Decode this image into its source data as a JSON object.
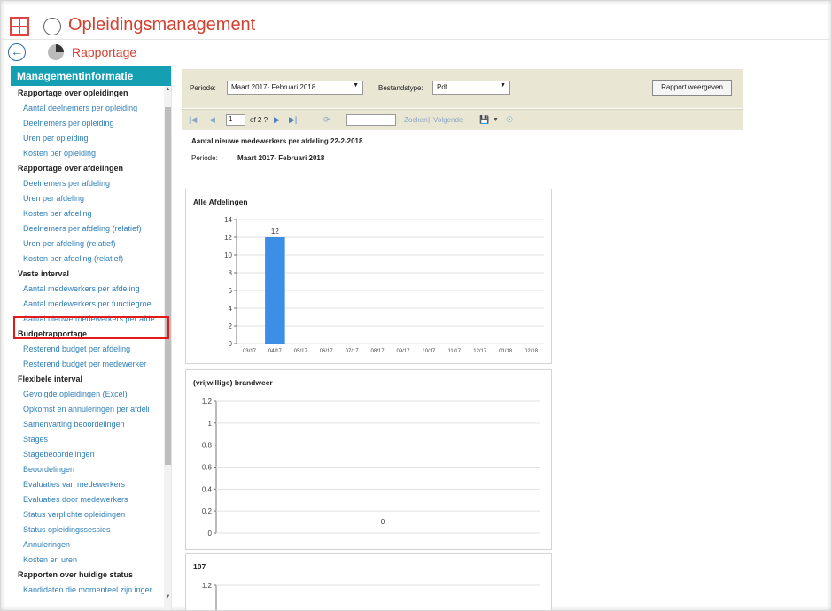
{
  "app": {
    "title": "Opleidingsmanagement",
    "subtitle": "Rapportage"
  },
  "sidebar": {
    "header": "Managementinformatie",
    "items": [
      {
        "type": "section",
        "label": "Rapportage over opleidingen"
      },
      {
        "type": "link",
        "label": "Aantal deelnemers per opleiding"
      },
      {
        "type": "link",
        "label": "Deelnemers per opleiding"
      },
      {
        "type": "link",
        "label": "Uren per opleiding"
      },
      {
        "type": "link",
        "label": "Kosten per opleiding"
      },
      {
        "type": "section",
        "label": "Rapportage over afdelingen"
      },
      {
        "type": "link",
        "label": "Deelnemers per afdeling"
      },
      {
        "type": "link",
        "label": "Uren per afdeling"
      },
      {
        "type": "link",
        "label": "Kosten per afdeling"
      },
      {
        "type": "link",
        "label": "Deelnemers per afdeling (relatief)"
      },
      {
        "type": "link",
        "label": "Uren per afdeling (relatief)"
      },
      {
        "type": "link",
        "label": "Kosten per afdeling (relatief)"
      },
      {
        "type": "section",
        "label": "Vaste interval"
      },
      {
        "type": "link",
        "label": "Aantal medewerkers per afdeling"
      },
      {
        "type": "link",
        "label": "Aantal medewerkers per functiegroe"
      },
      {
        "type": "link",
        "label": "Aantal nieuwe medewerkers per afde"
      },
      {
        "type": "section",
        "label": "Budgetrapportage"
      },
      {
        "type": "link",
        "label": "Resterend budget per afdeling"
      },
      {
        "type": "link",
        "label": "Resterend budget per medewerker"
      },
      {
        "type": "section",
        "label": "Flexibele interval"
      },
      {
        "type": "link",
        "label": "Gevolgde opleidingen (Excel)"
      },
      {
        "type": "link",
        "label": "Opkomst en annuleringen per afdeli"
      },
      {
        "type": "link",
        "label": "Samenvatting beoordelingen"
      },
      {
        "type": "link",
        "label": "Stages"
      },
      {
        "type": "link",
        "label": "Stagebeoordelingen"
      },
      {
        "type": "link",
        "label": "Beoordelingen"
      },
      {
        "type": "link",
        "label": "Evaluaties van medewerkers"
      },
      {
        "type": "link",
        "label": "Evaluaties door medewerkers"
      },
      {
        "type": "link",
        "label": "Status verplichte opleidingen"
      },
      {
        "type": "link",
        "label": "Status opleidingssessies"
      },
      {
        "type": "link",
        "label": "Annuleringen"
      },
      {
        "type": "link",
        "label": "Kosten en uren"
      },
      {
        "type": "section",
        "label": "Rapporten over huidige status"
      },
      {
        "type": "link",
        "label": "Kandidaten die momenteel zijn inger"
      }
    ]
  },
  "params": {
    "period_label": "Periode:",
    "period_value": "Maart 2017- Februari 2018",
    "filetype_label": "Bestandstype:",
    "filetype_value": "Pdf",
    "run_button": "Rapport weergeven"
  },
  "toolbar": {
    "page_value": "1",
    "page_of": "of 2 ?",
    "find_label": "Zoeken",
    "next_label": "Volgende"
  },
  "report": {
    "heading": "Aantal nieuwe medewerkers per afdeling 22-2-2018",
    "period_label": "Periode:",
    "period_value": "Maart 2017- Februari 2018"
  },
  "chart_data": [
    {
      "type": "bar",
      "title": "Alle Afdelingen",
      "categories": [
        "03/17",
        "04/17",
        "05/17",
        "06/17",
        "07/17",
        "08/17",
        "09/17",
        "10/17",
        "11/17",
        "12/17",
        "01/18",
        "02/18"
      ],
      "values": [
        0,
        12,
        0,
        0,
        0,
        0,
        0,
        0,
        0,
        0,
        0,
        0
      ],
      "data_labels": [
        "",
        "12",
        "",
        "",
        "",
        "",
        "",
        "",
        "",
        "",
        "",
        ""
      ],
      "yticks": [
        0,
        2,
        4,
        6,
        8,
        10,
        12,
        14
      ],
      "ylim": [
        0,
        14
      ],
      "bar_color": "#3d8ee6"
    },
    {
      "type": "bar",
      "title": "(vrijwillige) brandweer",
      "categories": [],
      "values": [
        0
      ],
      "data_labels": [
        "0"
      ],
      "yticks": [
        "0",
        "0.2",
        "0.4",
        "0.6",
        "0.8",
        "1",
        "1.2"
      ],
      "ylim": [
        0,
        1.2
      ]
    },
    {
      "type": "bar",
      "title": "107",
      "categories": [],
      "values": [],
      "yticks": [
        "1.2"
      ],
      "ylim": [
        0,
        1.2
      ]
    }
  ]
}
